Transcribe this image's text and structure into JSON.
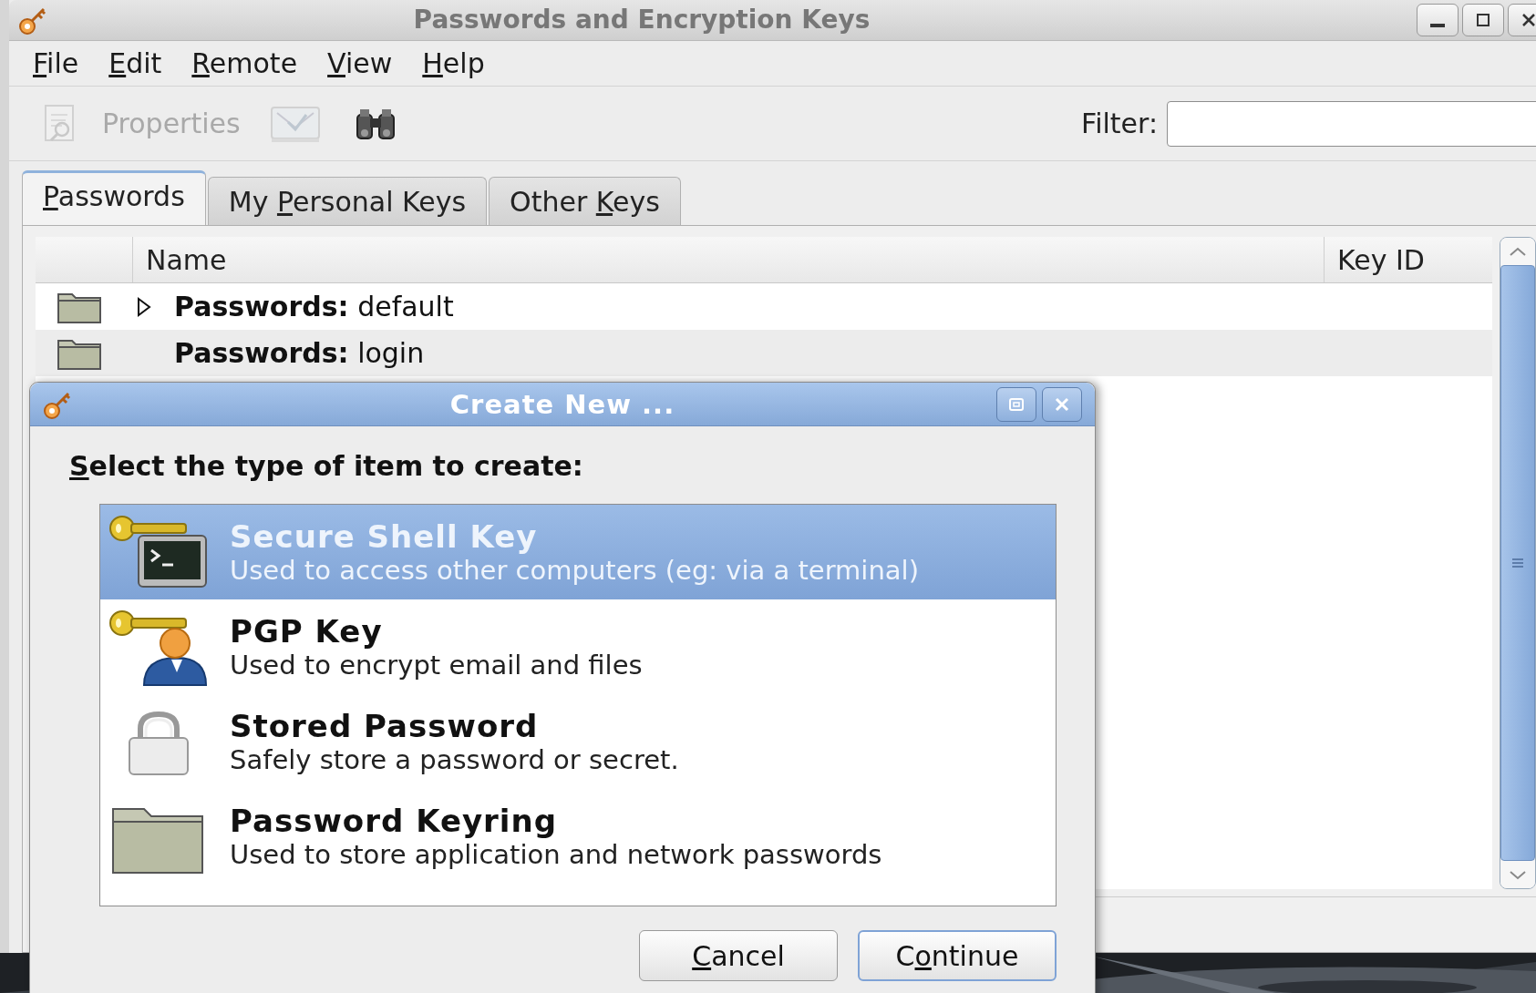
{
  "window": {
    "title": "Passwords and Encryption Keys"
  },
  "menu": [
    {
      "key": "F",
      "post": "ile"
    },
    {
      "key": "E",
      "post": "dit"
    },
    {
      "key": "R",
      "post": "emote"
    },
    {
      "key": "V",
      "post": "iew"
    },
    {
      "key": "H",
      "post": "elp"
    }
  ],
  "toolbar": [
    {
      "kind": "properties",
      "label": "Properties",
      "disabled": true
    },
    {
      "kind": "export",
      "disabled": true
    },
    {
      "kind": "find",
      "disabled": false
    }
  ],
  "filter": {
    "label": "Filter:"
  },
  "tabs": [
    {
      "key": "P",
      "post": "asswords",
      "selected": true
    },
    {
      "pre": "My ",
      "key": "P",
      "post": "ersonal Keys",
      "selected": false
    },
    {
      "pre": "Other ",
      "key": "K",
      "post": "eys",
      "selected": false
    }
  ],
  "table": {
    "columns": [
      "Name",
      "Key ID"
    ],
    "rows": [
      {
        "name": "**Passwords:** default",
        "expanded": false
      },
      {
        "name": "**Passwords:** login"
      }
    ]
  },
  "dialog": {
    "title": "Create New ...",
    "heading": {
      "key": "S",
      "post": "elect the type of item to create:"
    },
    "items": [
      {
        "kind": "ssh",
        "title": "Secure Shell Key",
        "description": "Used to access other computers (eg: via a terminal)",
        "selected": true
      },
      {
        "kind": "pgp",
        "title": "PGP Key",
        "description": "Used to encrypt email and files",
        "selected": false
      },
      {
        "kind": "password",
        "title": "Stored Password",
        "description": "Safely store a password or secret.",
        "selected": false
      },
      {
        "kind": "keyring",
        "title": "Password Keyring",
        "description": "Used to store application and network passwords",
        "selected": false
      }
    ],
    "buttons": [
      {
        "key": "C",
        "post": "ancel",
        "default": false
      },
      {
        "pre": "C",
        "key": "o",
        "post": "ntinue",
        "default": true
      }
    ]
  }
}
